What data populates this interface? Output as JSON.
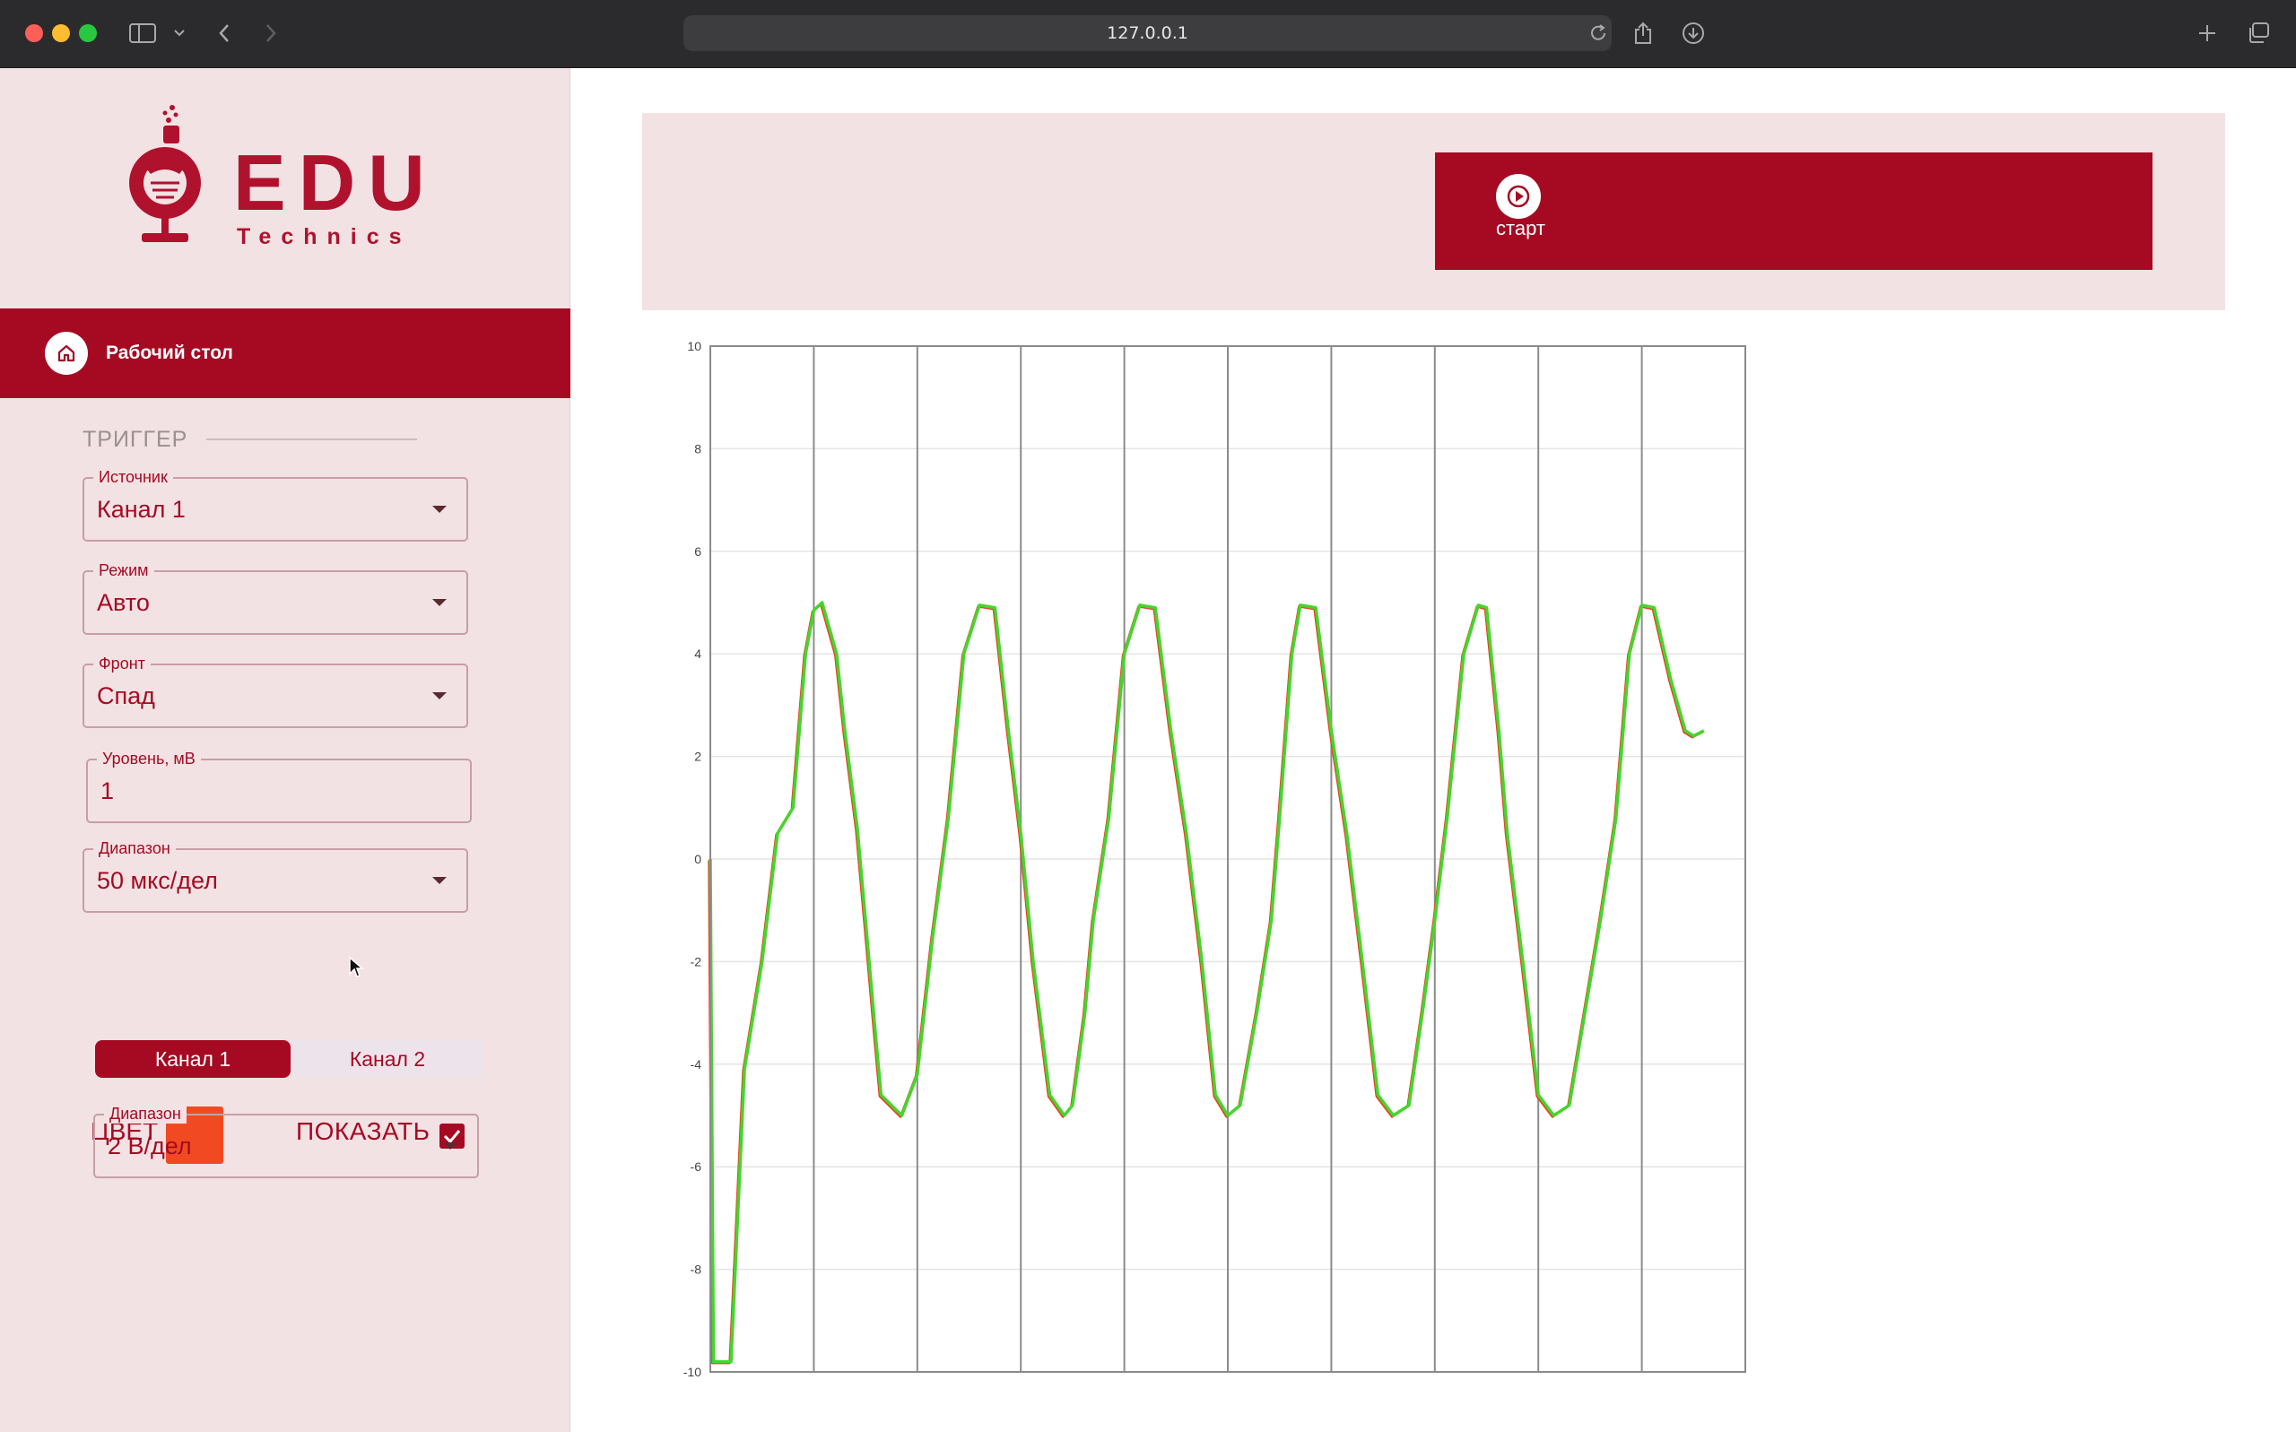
{
  "browser": {
    "url": "127.0.0.1"
  },
  "logo": {
    "title": "EDU",
    "subtitle": "Technics"
  },
  "nav": {
    "active_label": "Рабочий стол"
  },
  "trigger": {
    "section_title": "ТРИГГЕР",
    "source": {
      "label": "Источник",
      "value": "Канал 1"
    },
    "mode": {
      "label": "Режим",
      "value": "Авто"
    },
    "edge": {
      "label": "Фронт",
      "value": "Спад"
    },
    "level": {
      "label": "Уровень, мВ",
      "value": "1"
    },
    "range": {
      "label": "Диапазон",
      "value": "50 мкс/дел"
    }
  },
  "channels": {
    "tabs": [
      "Канал 1",
      "Канал 2"
    ],
    "active_tab": "Канал 1",
    "color_label": "ЦВЕТ",
    "color_value": "#f14a22",
    "show_label": "ПОКАЗАТЬ",
    "show_checked": true,
    "range": {
      "label": "Диапазон",
      "value": "2 В/дел"
    }
  },
  "controls": {
    "start_label": "старт"
  },
  "colors": {
    "accent": "#a60a23",
    "sidebar_bg": "#f2e2e3",
    "trace_green": "#44d62c",
    "trace_red": "#e8401f"
  },
  "chart_data": {
    "type": "line",
    "title": "",
    "xlabel": "",
    "ylabel": "",
    "ylim": [
      -10,
      10
    ],
    "xlim": [
      0,
      10
    ],
    "yticks": [
      "10",
      "8",
      "6",
      "4",
      "2",
      "0",
      "-2",
      "-4",
      "-6",
      "-8",
      "-10"
    ],
    "x_gridlines": 10,
    "grid": true,
    "series": [
      {
        "color": "#44d62c",
        "x": [
          0,
          0.03,
          0.05,
          0.2,
          0.33,
          0.5,
          0.65,
          0.8,
          0.92,
          1.0,
          1.08,
          1.22,
          1.3,
          1.42,
          1.5,
          1.6,
          1.65,
          1.85,
          2.0,
          2.15,
          2.3,
          2.45,
          2.6,
          2.75,
          2.88,
          3.0,
          3.12,
          3.28,
          3.42,
          3.5,
          3.62,
          3.7,
          3.85,
          4.0,
          4.15,
          4.3,
          4.45,
          4.6,
          4.75,
          4.88,
          5.0,
          5.12,
          5.28,
          5.42,
          5.5,
          5.62,
          5.7,
          5.85,
          6.0,
          6.15,
          6.3,
          6.45,
          6.6,
          6.75,
          6.88,
          7.0,
          7.12,
          7.28,
          7.42,
          7.5,
          7.62,
          7.7,
          7.85,
          8.0,
          8.15,
          8.3,
          8.45,
          8.6,
          8.75,
          8.88,
          9.0,
          9.12,
          9.28,
          9.42,
          9.5,
          9.6
        ],
        "y": [
          0,
          -9.8,
          -9.8,
          -9.8,
          -4.1,
          -2.0,
          0.5,
          1.0,
          4.0,
          4.85,
          5.0,
          4.0,
          2.5,
          0.6,
          -1.2,
          -3.5,
          -4.6,
          -5.0,
          -4.2,
          -1.5,
          0.8,
          4.0,
          4.95,
          4.9,
          2.5,
          0.5,
          -2.0,
          -4.6,
          -5.0,
          -4.8,
          -3.0,
          -1.2,
          0.8,
          4.0,
          4.95,
          4.9,
          2.5,
          0.5,
          -2.0,
          -4.6,
          -5.0,
          -4.8,
          -3.0,
          -1.2,
          0.8,
          4.0,
          4.95,
          4.9,
          2.5,
          0.5,
          -2.0,
          -4.6,
          -5.0,
          -4.8,
          -3.0,
          -1.2,
          0.8,
          4.0,
          4.95,
          4.9,
          2.5,
          0.5,
          -2.0,
          -4.6,
          -5.0,
          -4.8,
          -3.0,
          -1.2,
          0.8,
          4.0,
          4.95,
          4.9,
          3.5,
          2.5,
          2.4,
          2.5
        ]
      }
    ]
  }
}
